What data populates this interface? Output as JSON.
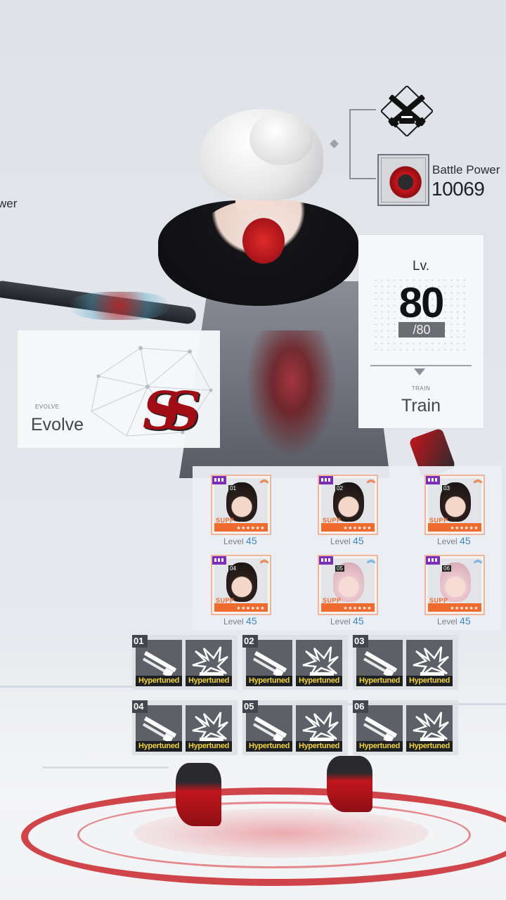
{
  "header": {
    "left_label_partial": "wer"
  },
  "weapon": {
    "class_icon": "crossed-rifles-icon",
    "thumb_icon": "weapon-thumbnail",
    "battle_power_label": "Battle Power",
    "battle_power_value": "10069"
  },
  "level_card": {
    "lv_label": "Lv.",
    "level": "80",
    "max_level": "/80",
    "train_small": "TRAIN",
    "train_big": "Train"
  },
  "evolve_card": {
    "evolve_small": "EVOLVE",
    "evolve_big": "Evolve",
    "grade": "SS"
  },
  "support": {
    "slots": [
      {
        "num": "01",
        "rank_text": "SUPP",
        "level_label": "Level",
        "level": "45",
        "chevron": "up-orange",
        "tone": "dark"
      },
      {
        "num": "02",
        "rank_text": "SUPP",
        "level_label": "Level",
        "level": "45",
        "chevron": "up-orange",
        "tone": "dark"
      },
      {
        "num": "03",
        "rank_text": "SUPP",
        "level_label": "Level",
        "level": "45",
        "chevron": "up-orange",
        "tone": "dark"
      },
      {
        "num": "04",
        "rank_text": "SUPP",
        "level_label": "Level",
        "level": "45",
        "chevron": "up-orange",
        "tone": "dark"
      },
      {
        "num": "05",
        "rank_text": "SUPP",
        "level_label": "Level",
        "level": "45",
        "chevron": "up-blue",
        "tone": "light"
      },
      {
        "num": "06",
        "rank_text": "SUPP",
        "level_label": "Level",
        "level": "45",
        "chevron": "up-blue",
        "tone": "light"
      }
    ],
    "stars": "★★★★★★"
  },
  "gear": {
    "groups": [
      {
        "num": "01",
        "left_tag": "Hypertuned",
        "right_tag": "Hypertuned"
      },
      {
        "num": "02",
        "left_tag": "Hypertuned",
        "right_tag": "Hypertuned"
      },
      {
        "num": "03",
        "left_tag": "Hypertuned",
        "right_tag": "Hypertuned"
      },
      {
        "num": "04",
        "left_tag": "Hypertuned",
        "right_tag": "Hypertuned"
      },
      {
        "num": "05",
        "left_tag": "Hypertuned",
        "right_tag": "Hypertuned"
      },
      {
        "num": "06",
        "left_tag": "Hypertuned",
        "right_tag": "Hypertuned"
      }
    ],
    "left_icon": "blade-module-icon",
    "right_icon": "spark-burst-module-icon"
  },
  "colors": {
    "accent_red": "#c9262c",
    "hypertuned_yellow": "#f1d33d",
    "rank_orange": "#ee6a2d",
    "level_blue": "#3f86c9"
  }
}
